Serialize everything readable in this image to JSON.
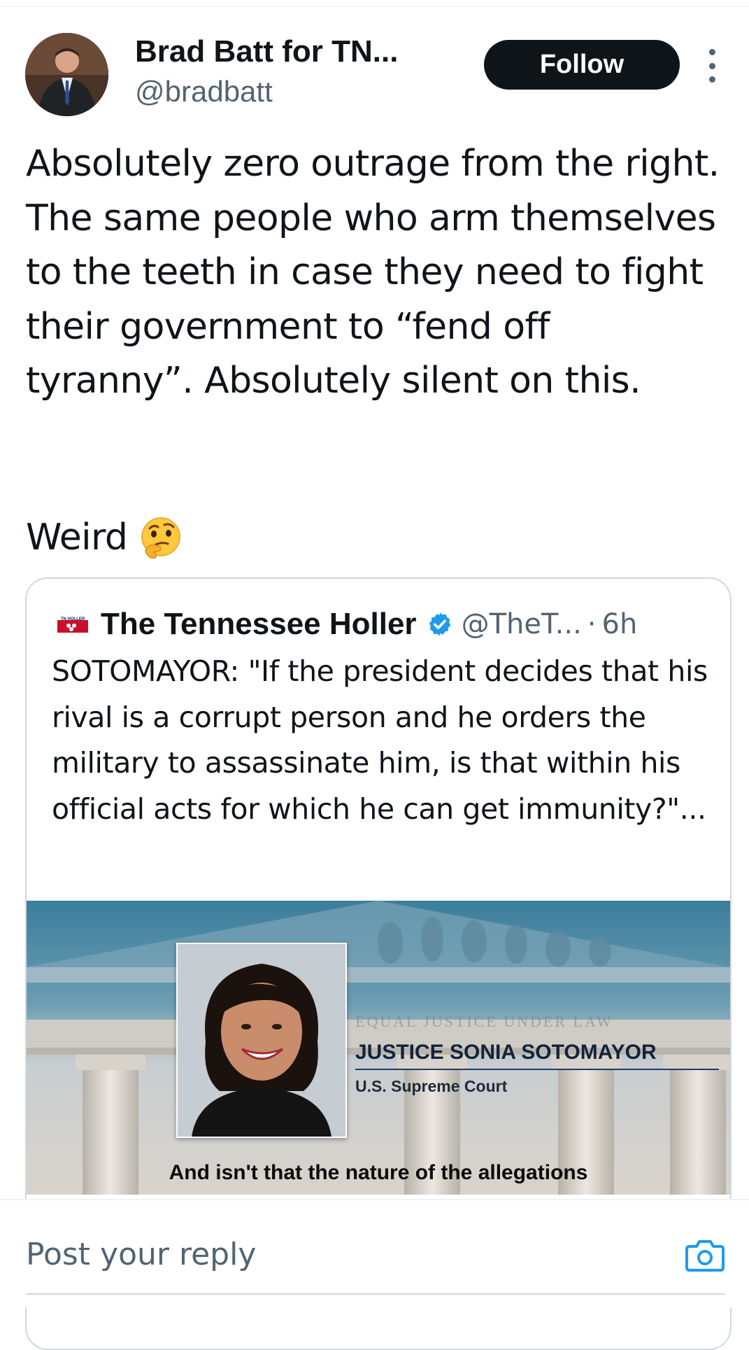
{
  "post": {
    "author_name": "Brad Batt for TN...",
    "author_handle": "@bradbatt",
    "follow_label": "Follow",
    "text": "Absolutely zero outrage from the right. The same people who arm themselves to the teeth in case they need to fight their government to “fend off tyranny”. Absolutely silent on this.",
    "text_tail": "Weird",
    "emoji_icon": "thinking-face-icon"
  },
  "quote": {
    "logo_text": "TN HOLLER",
    "author_name": "The Tennessee Holler",
    "verified_icon": "verified-badge-icon",
    "author_handle": "@TheT...",
    "separator": "·",
    "time": "6h",
    "text": "SOTOMAYOR: \"If the president decides that his rival is a corrupt person and he orders the military to assassinate him, is that within his official acts for which he can get immunity?\"...",
    "media": {
      "frieze_text": "EQUAL JUSTICE UNDER LAW",
      "lower_third_name": "JUSTICE SONIA SOTOMAYOR",
      "lower_third_title": "U.S. Supreme Court",
      "caption": "And isn't that the nature of the allegations"
    }
  },
  "reply": {
    "placeholder": "Post your reply",
    "camera_icon": "camera-icon"
  },
  "colors": {
    "text_primary": "#0f1419",
    "text_secondary": "#536471",
    "border": "#cfd9de",
    "follow_bg": "#0f1419",
    "verified": "#1d9bf0",
    "camera": "#1d9bf0"
  }
}
